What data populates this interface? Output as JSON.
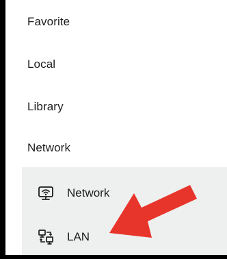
{
  "menu": {
    "sections": [
      {
        "label": "Favorite"
      },
      {
        "label": "Local"
      },
      {
        "label": "Library"
      },
      {
        "label": "Network"
      }
    ],
    "network_items": [
      {
        "label": "Network",
        "icon": "wifi-monitor-icon"
      },
      {
        "label": "LAN",
        "icon": "lan-computers-icon"
      }
    ]
  },
  "annotation": {
    "arrow_color": "#e8352b",
    "arrow_target": "LAN"
  },
  "colors": {
    "background": "#ffffff",
    "subpanel_background": "#eef0ef",
    "text": "#1c1c1c",
    "frame": "#000000"
  }
}
